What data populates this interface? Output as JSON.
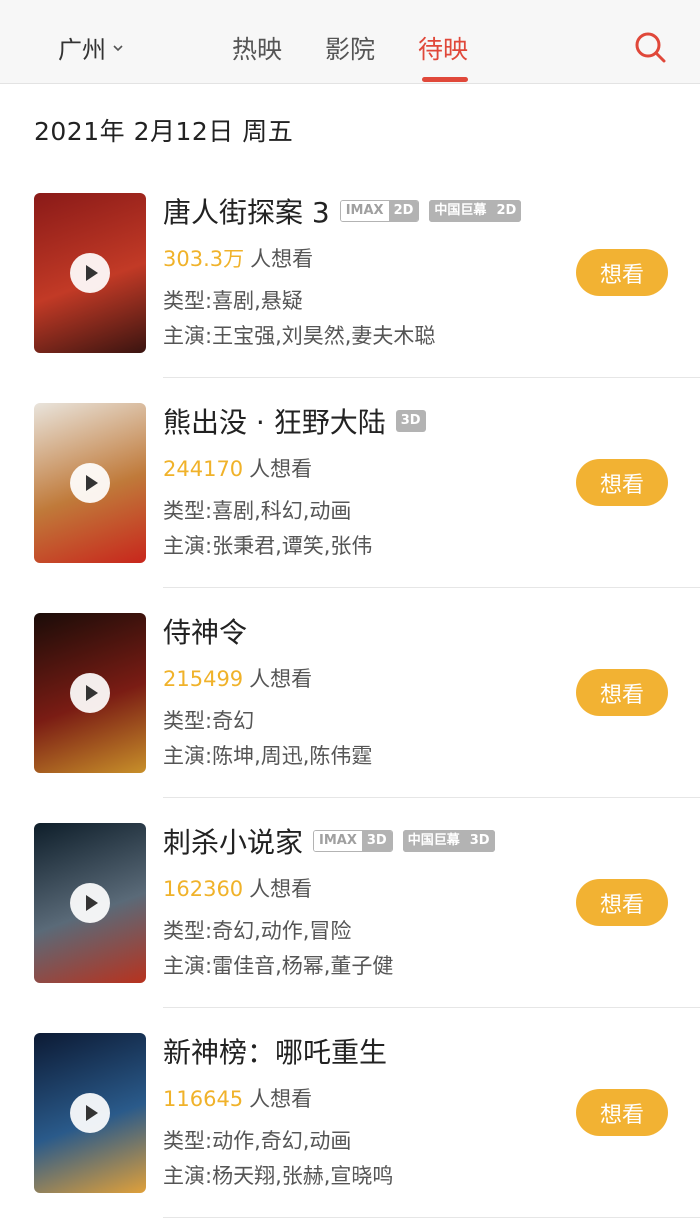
{
  "header": {
    "city": "广州",
    "tabs": [
      {
        "label": "热映"
      },
      {
        "label": "影院"
      },
      {
        "label": "待映"
      }
    ],
    "active_tab": "待映",
    "accent_color": "#e0483a"
  },
  "date_label": "2021年 2月12日 周五",
  "want_button_label": "想看",
  "want_suffix": "人想看",
  "movies": [
    {
      "title": "唐人街探案 3",
      "badges": [
        {
          "type": "imax",
          "a": "IMAX",
          "b": "2D"
        },
        {
          "type": "gray",
          "a": "中国巨幕",
          "b": "2D"
        }
      ],
      "want_count": "303.3万",
      "genre": "类型:喜剧,悬疑",
      "cast": "主演:王宝强,刘昊然,妻夫木聪",
      "poster_colors": [
        "#8a1a18",
        "#c23a26",
        "#3a1410"
      ]
    },
    {
      "title": "熊出没 · 狂野大陆",
      "badges": [
        {
          "type": "gray",
          "a": "3D",
          "b": ""
        }
      ],
      "want_count": "244170",
      "genre": "类型:喜剧,科幻,动画",
      "cast": "主演:张秉君,谭笑,张伟",
      "poster_colors": [
        "#e9e4dc",
        "#c07a3a",
        "#c8261c"
      ]
    },
    {
      "title": "侍神令",
      "badges": [],
      "want_count": "215499",
      "genre": "类型:奇幻",
      "cast": "主演:陈坤,周迅,陈伟霆",
      "poster_colors": [
        "#1a0c08",
        "#7a1c14",
        "#c8902a"
      ]
    },
    {
      "title": "刺杀小说家",
      "badges": [
        {
          "type": "imax",
          "a": "IMAX",
          "b": "3D"
        },
        {
          "type": "gray",
          "a": "中国巨幕",
          "b": "3D"
        }
      ],
      "want_count": "162360",
      "genre": "类型:奇幻,动作,冒险",
      "cast": "主演:雷佳音,杨幂,董子健",
      "poster_colors": [
        "#0e1e2a",
        "#5a6a78",
        "#b8321e"
      ]
    },
    {
      "title": "新神榜：哪吒重生",
      "badges": [],
      "want_count": "116645",
      "genre": "类型:动作,奇幻,动画",
      "cast": "主演:杨天翔,张赫,宣晓鸣",
      "poster_colors": [
        "#0c1a34",
        "#2a5a8a",
        "#e0a03a"
      ]
    }
  ]
}
